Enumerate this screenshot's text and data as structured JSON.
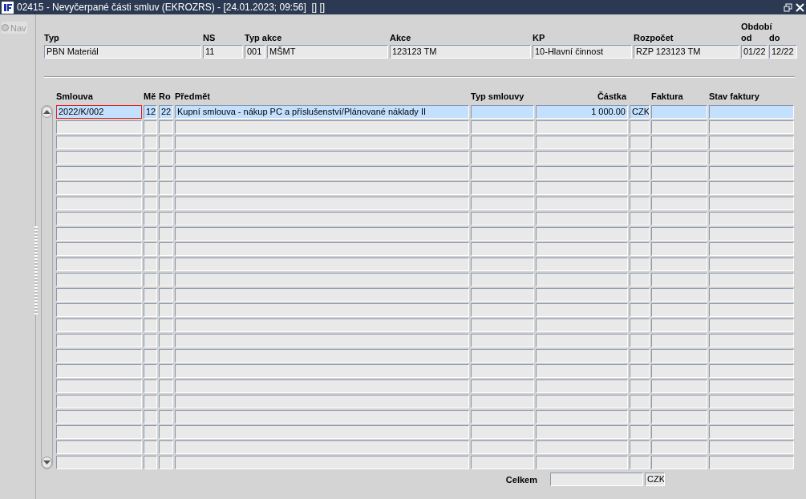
{
  "window": {
    "title": "02415 - Nevyčerpané části smluv (EKROZRS) - [24.01.2023; 09:56]  [] []"
  },
  "navigator": {
    "label": "Nav",
    "selected": false
  },
  "header": {
    "labels": {
      "typ": "Typ",
      "ns": "NS",
      "typ_akce": "Typ akce",
      "akce": "Akce",
      "kp": "KP",
      "rozpocet": "Rozpočet",
      "obdobi": "Období",
      "od": "od",
      "do": "do"
    },
    "values": {
      "typ": "PBN Materiál",
      "ns": "11",
      "typ_akce_code": "001",
      "typ_akce_name": "MŠMT",
      "akce": "123123 TM",
      "kp": "10-Hlavní činnost",
      "rozpocet": "RZP 123123 TM",
      "od": "01/22",
      "do": "12/22"
    }
  },
  "table": {
    "columns": [
      {
        "kind": "text",
        "label": "Smlouva"
      },
      {
        "kind": "text",
        "label": "Mě"
      },
      {
        "kind": "text",
        "label": "Ro"
      },
      {
        "kind": "text",
        "label": "Předmět"
      },
      {
        "kind": "text",
        "label": "Typ smlouvy"
      },
      {
        "kind": "amount",
        "label": "Částka"
      },
      {
        "kind": "text"
      },
      {
        "kind": "text",
        "label": "Faktura"
      },
      {
        "kind": "text",
        "label": "Stav faktury"
      }
    ],
    "rows": [
      {
        "selected": true,
        "cells": [
          {
            "text": "2022/K/002",
            "focused": true
          },
          {
            "text": "12",
            "focused": false
          },
          {
            "text": "22",
            "focused": false
          },
          {
            "text": "Kupní smlouva - nákup PC a příslušenství/Plánované náklady II",
            "focused": false
          },
          null,
          {
            "text": "1 000.00",
            "focused": false
          },
          {
            "text": "CZK",
            "focused": false
          },
          null,
          null
        ]
      },
      {
        "selected": false
      },
      {
        "selected": false
      },
      {
        "selected": false
      },
      {
        "selected": false
      },
      {
        "selected": false
      },
      {
        "selected": false
      },
      {
        "selected": false
      },
      {
        "selected": false
      },
      {
        "selected": false
      },
      {
        "selected": false
      },
      {
        "selected": false
      },
      {
        "selected": false
      },
      {
        "selected": false
      },
      {
        "selected": false
      },
      {
        "selected": false
      },
      {
        "selected": false
      },
      {
        "selected": false
      },
      {
        "selected": false
      },
      {
        "selected": false
      },
      {
        "selected": false
      },
      {
        "selected": false
      },
      {
        "selected": false
      },
      {
        "selected": false
      }
    ]
  },
  "total": {
    "label": "Celkem",
    "currency": "CZK"
  }
}
